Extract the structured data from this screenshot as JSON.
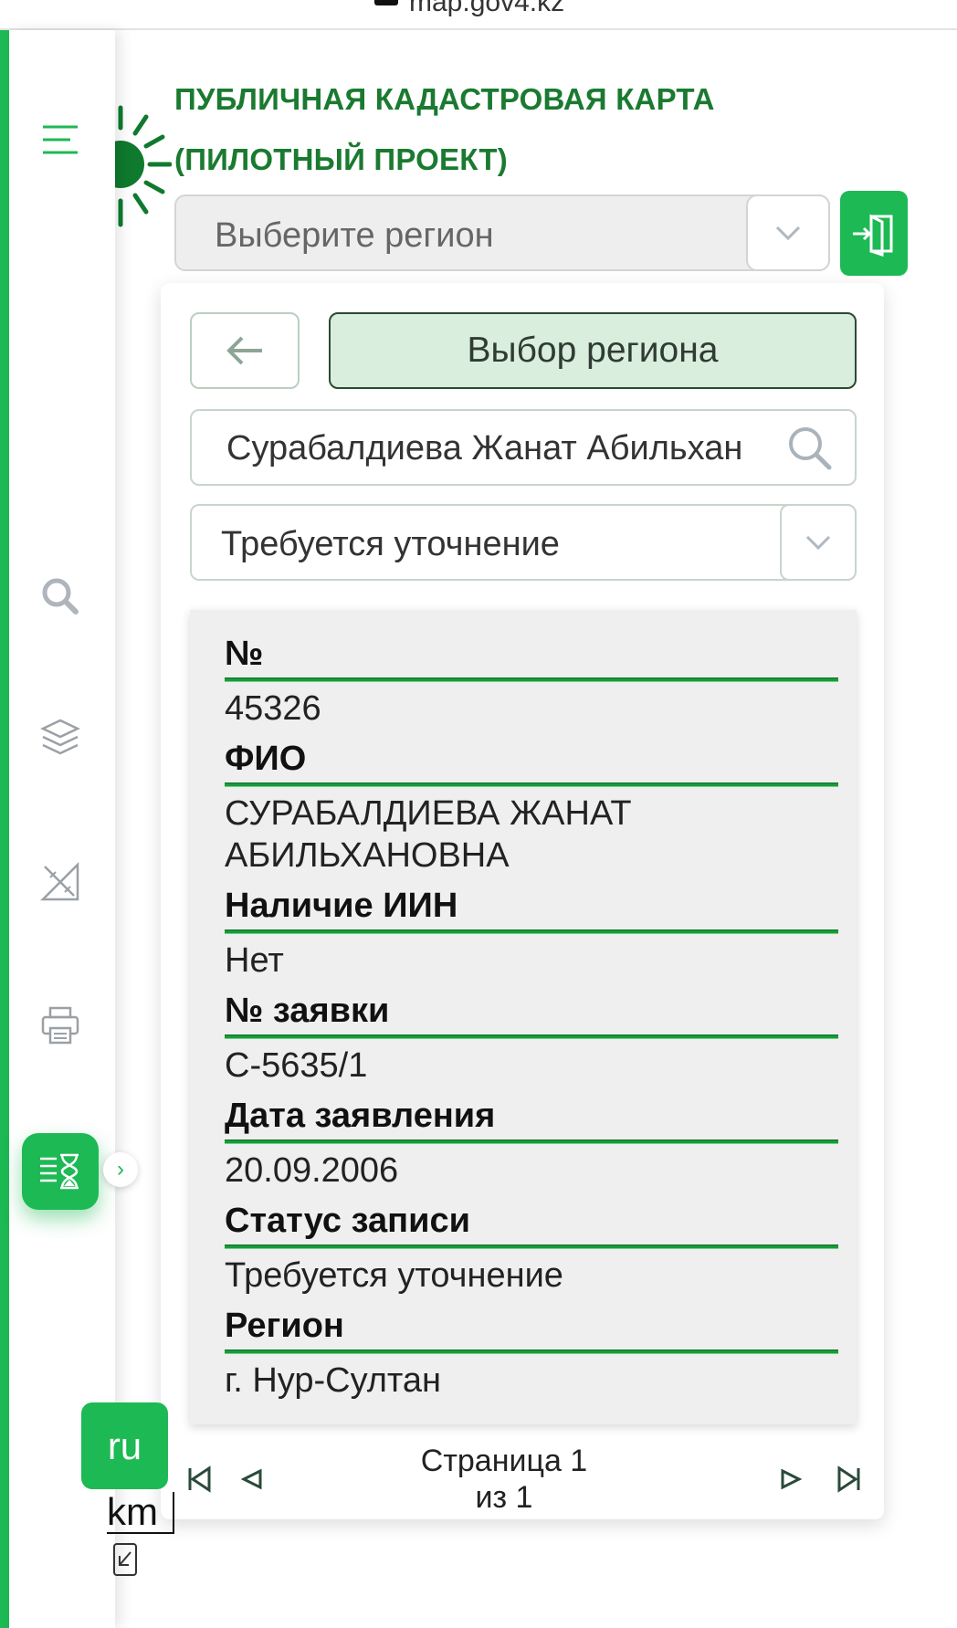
{
  "browser": {
    "url": "map.gov4.kz"
  },
  "header": {
    "title_line1": "ПУБЛИЧНАЯ КАДАСТРОВАЯ КАРТА",
    "title_line2": "(ПИЛОТНЫЙ ПРОЕКТ)",
    "region_placeholder": "Выберите регион"
  },
  "sidebar": {
    "items": [
      "menu-icon",
      "search-icon",
      "layers-icon",
      "measure-icon",
      "print-icon",
      "queue-icon"
    ],
    "active": "queue-icon"
  },
  "panel": {
    "choose_region_label": "Выбор региона",
    "search_value": "Сурабалдиева Жанат Абильхан ",
    "status_filter": "Требуется уточнение"
  },
  "record": {
    "fields": [
      {
        "label": "№",
        "value": "45326"
      },
      {
        "label": "ФИО",
        "value": "СУРАБАЛДИЕВА ЖАНАТ АБИЛЬХАНОВНА"
      },
      {
        "label": "Наличие ИИН",
        "value": "Нет"
      },
      {
        "label": "№ заявки",
        "value": "С-5635/1"
      },
      {
        "label": "Дата заявления",
        "value": "20.09.2006"
      },
      {
        "label": "Статус записи",
        "value": "Требуется уточнение"
      },
      {
        "label": "Регион",
        "value": "г. Нур-Султан"
      }
    ]
  },
  "pager": {
    "line1": "Страница 1",
    "line2": "из 1"
  },
  "language": "ru",
  "map_scale": "km",
  "colors": {
    "accent": "#1db954",
    "title_green": "#1a7a30",
    "line_green": "#1a9a3a"
  }
}
